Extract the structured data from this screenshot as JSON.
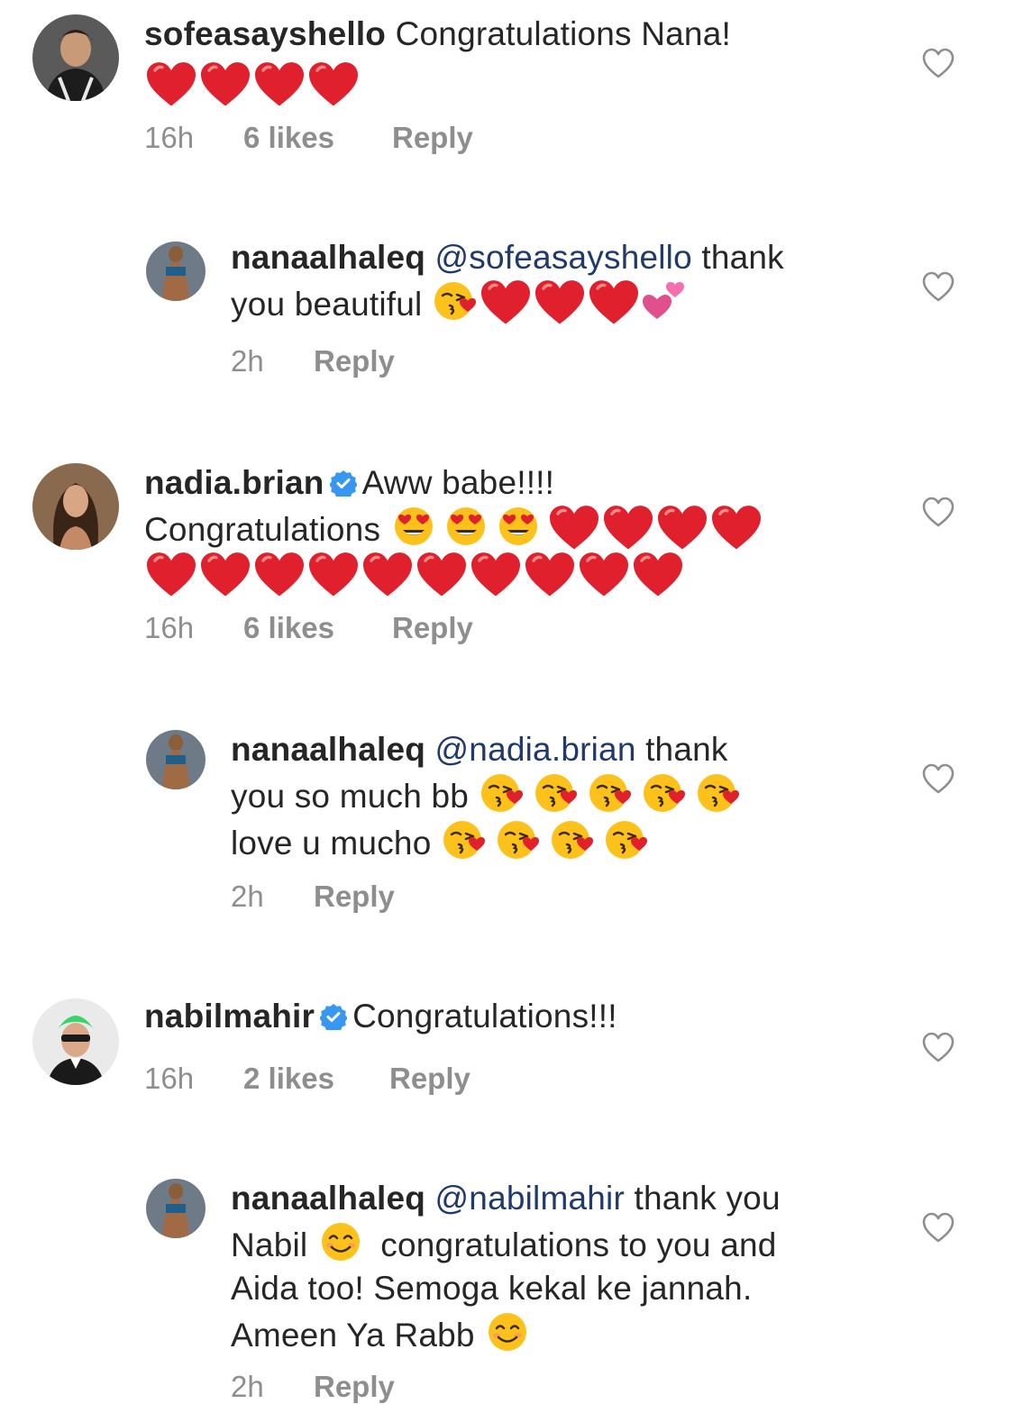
{
  "comments": [
    {
      "username": "sofeasayshello",
      "text_before": "Congratulations Nana!",
      "emoji_seq": [
        "heart",
        "heart",
        "heart",
        "heart"
      ],
      "time": "16h",
      "likes": "6 likes",
      "reply": "Reply"
    },
    {
      "username": "nanaalhaleq",
      "mention": "@sofeasayshello",
      "text_line1": "thank",
      "text_line2": "you beautiful",
      "emoji_seq": [
        "kiss",
        "heart",
        "heart",
        "heart",
        "twohearts"
      ],
      "time": "2h",
      "reply": "Reply"
    },
    {
      "username": "nadia.brian",
      "text_line1": "Aww babe!!!!",
      "text_line2": "Congratulations",
      "emoji_seq_line2": [
        "hearteyes",
        "hearteyes",
        "hearteyes",
        "heart",
        "heart",
        "heart",
        "heart"
      ],
      "emoji_seq_line3": [
        "heart",
        "heart",
        "heart",
        "heart",
        "heart",
        "heart",
        "heart",
        "heart",
        "heart",
        "heart"
      ],
      "time": "16h",
      "likes": "6 likes",
      "reply": "Reply"
    },
    {
      "username": "nanaalhaleq",
      "mention": "@nadia.brian",
      "text_line1": "thank",
      "text_line2": "you so much bb",
      "emoji_seq_line2": [
        "kiss",
        "kiss",
        "kiss",
        "kiss",
        "kiss"
      ],
      "text_line3": "love u mucho",
      "emoji_seq_line3": [
        "kiss",
        "kiss",
        "kiss",
        "kiss"
      ],
      "time": "2h",
      "reply": "Reply"
    },
    {
      "username": "nabilmahir",
      "text_line1": "Congratulations!!!",
      "time": "16h",
      "likes": "2 likes",
      "reply": "Reply"
    },
    {
      "username": "nanaalhaleq",
      "mention": "@nabilmahir",
      "text_line1": "thank you",
      "text_line2a": "Nabil",
      "text_line2b": "congratulations to you and",
      "text_line3": "Aida too! Semoga kekal ke jannah.",
      "text_line4": "Ameen Ya Rabb",
      "time": "2h",
      "reply": "Reply"
    }
  ],
  "colors": {
    "text": "#262626",
    "meta": "#8e8e8e",
    "mention": "#1f3a6b",
    "verified": "#3897f0",
    "heart_emoji": "#e0202c"
  }
}
